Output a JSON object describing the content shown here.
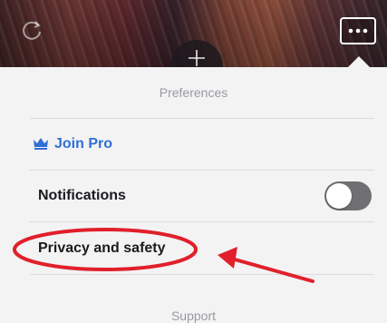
{
  "menu": {
    "section_preferences": "Preferences",
    "join_pro_label": "Join Pro",
    "notifications_label": "Notifications",
    "notifications_enabled": false,
    "privacy_label": "Privacy and safety",
    "section_support": "Support"
  },
  "colors": {
    "accent": "#2f6fd6",
    "annotation": "#e0202a"
  },
  "icons": {
    "refresh": "refresh-icon",
    "plus": "plus-icon",
    "more": "more-icon",
    "crown": "crown-icon"
  }
}
